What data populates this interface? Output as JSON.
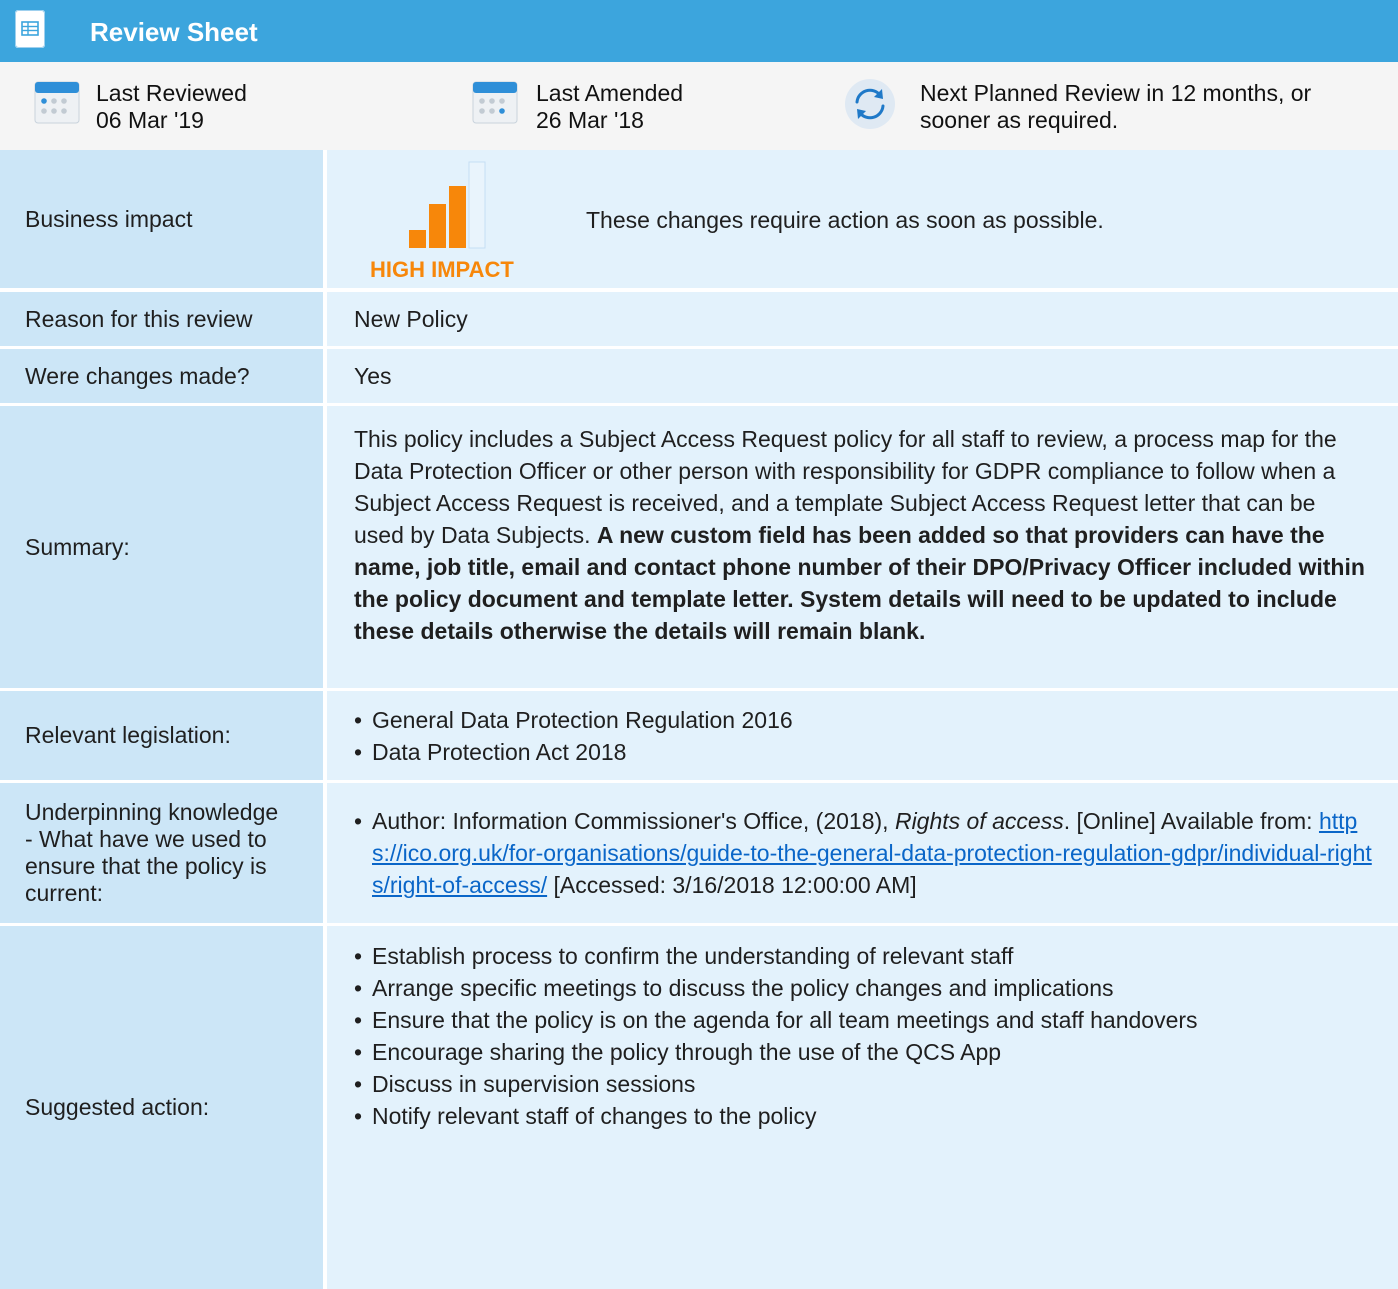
{
  "header": {
    "title": "Review Sheet",
    "icon": "spreadsheet-icon"
  },
  "meta": {
    "last_reviewed_label": "Last Reviewed",
    "last_reviewed_date": "06 Mar '19",
    "last_amended_label": "Last Amended",
    "last_amended_date": "26 Mar '18",
    "next_review_text": "Next Planned Review in 12 months, or sooner as required."
  },
  "rows": {
    "business_impact": {
      "label": "Business impact",
      "badge": "HIGH IMPACT",
      "text": "These changes require action as soon as possible."
    },
    "reason": {
      "label": "Reason for this review",
      "value": "New Policy"
    },
    "changes": {
      "label": "Were changes made?",
      "value": "Yes"
    },
    "summary": {
      "label": "Summary:",
      "text": "This policy includes a Subject Access Request policy for all staff to review, a process map for the Data Protection Officer or other person with responsibility for GDPR compliance to follow when a Subject Access Request is received, and a template Subject Access Request letter that can be used by Data Subjects.",
      "bold_text": "A new custom field has been added so that providers can have the name, job title, email and contact phone number of their DPO/Privacy Officer included within the policy document and template letter. System details will need to be updated to include these details otherwise the details will remain blank."
    },
    "legislation": {
      "label": "Relevant legislation:",
      "items": [
        "General Data Protection Regulation 2016",
        "Data Protection Act 2018"
      ]
    },
    "knowledge": {
      "label": "Underpinning knowledge - What have we used to ensure that the policy is current:",
      "prefix": "Author: Information Commissioner's Office, (2018),",
      "title": "Rights of access",
      "mid": ". [Online] Available from:",
      "link": "https://ico.org.uk/for-organisations/guide-to-the-general-data-protection-regulation-gdpr/individual-rights/right-of-access/",
      "accessed": "[Accessed: 3/16/2018 12:00:00 AM]"
    },
    "action": {
      "label": "Suggested action:",
      "items": [
        "Establish process to confirm the understanding of relevant staff",
        "Arrange specific meetings to discuss the policy changes and implications",
        "Ensure that the policy is on the agenda for all team meetings and staff handovers",
        "Encourage sharing the policy through the use of the QCS App",
        "Discuss in supervision sessions",
        "Notify relevant staff of changes to the policy"
      ]
    }
  },
  "colors": {
    "header_bg": "#3ca5dd",
    "label_bg": "#cce6f7",
    "value_bg": "#e3f2fc",
    "impact_orange": "#f7870a",
    "link": "#0a66c8"
  }
}
